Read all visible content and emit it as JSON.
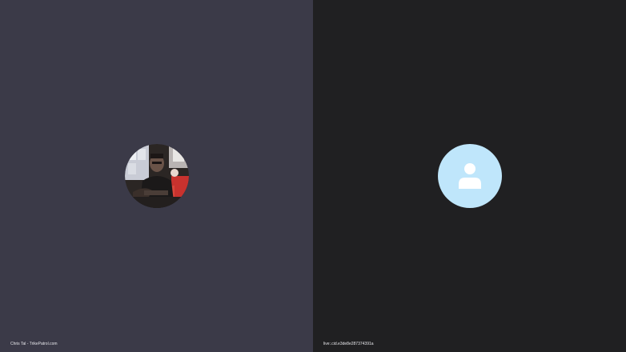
{
  "participants": [
    {
      "name": "Chris Tal - TrikePatrol.com",
      "avatar": "user-photo",
      "tile_color": "#3b3a48"
    },
    {
      "name": "live:.cid.e3de8e287374391a",
      "avatar": "default-user-icon",
      "tile_color": "#202022",
      "avatar_color": "#bfe6fb"
    }
  ]
}
